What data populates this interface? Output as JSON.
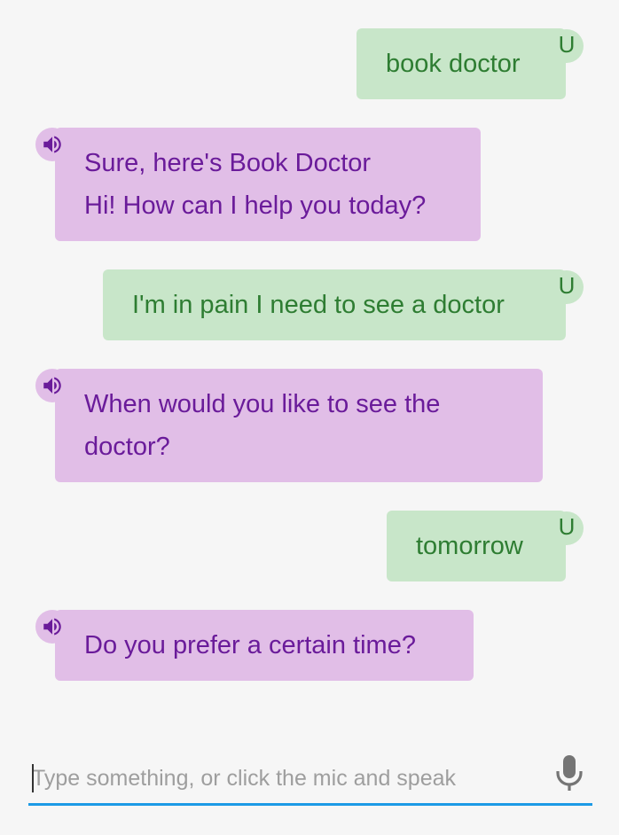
{
  "messages": [
    {
      "role": "user",
      "lines": [
        "book doctor"
      ],
      "avatar": "U"
    },
    {
      "role": "bot",
      "lines": [
        "Sure, here's Book Doctor",
        "Hi! How can I help you today?"
      ],
      "avatar_icon": "speaker-icon"
    },
    {
      "role": "user",
      "lines": [
        "I'm in pain I need to see a doctor"
      ],
      "avatar": "U"
    },
    {
      "role": "bot",
      "lines": [
        "When would you like to see the",
        "doctor?"
      ],
      "avatar_icon": "speaker-icon"
    },
    {
      "role": "user",
      "lines": [
        "tomorrow"
      ],
      "avatar": "U"
    },
    {
      "role": "bot",
      "lines": [
        "Do you prefer a certain time?"
      ],
      "avatar_icon": "speaker-icon"
    }
  ],
  "input": {
    "placeholder": "Type something, or click the mic and speak",
    "value": ""
  },
  "icons": {
    "mic": "microphone-icon",
    "bot_avatar": "speaker-icon"
  },
  "colors": {
    "user_bubble": "#c8e6c9",
    "user_text": "#2e7d32",
    "bot_bubble": "#e1bee7",
    "bot_text": "#6a1b9a",
    "background": "#f6f6f6",
    "input_underline": "#1c9ae6",
    "mic": "#757575"
  }
}
